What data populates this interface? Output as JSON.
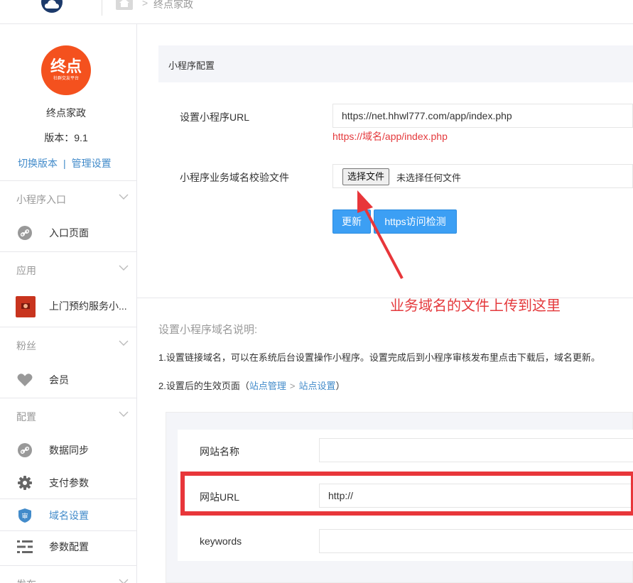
{
  "header": {
    "breadcrumb_sep": ">",
    "breadcrumb_current": "终点家政"
  },
  "sidebar": {
    "logo_big": "终点",
    "logo_small": "社群交友平台",
    "account_name": "终点家政",
    "version": "版本：9.1",
    "switch_version": "切换版本",
    "link_sep": "|",
    "manage_settings": "管理设置",
    "sections": [
      {
        "title": "小程序入口",
        "items": [
          {
            "label": "入口页面",
            "icon": "link-icon"
          }
        ]
      },
      {
        "title": "应用",
        "items": [
          {
            "label": "上门预约服务小...",
            "icon": "app-thumbnail"
          }
        ]
      },
      {
        "title": "粉丝",
        "items": [
          {
            "label": "会员",
            "icon": "heart-icon"
          }
        ]
      },
      {
        "title": "配置",
        "items": [
          {
            "label": "数据同步",
            "icon": "link-icon"
          },
          {
            "label": "支付参数",
            "icon": "gear-icon"
          },
          {
            "label": "域名设置",
            "icon": "shield-icon",
            "active": true
          },
          {
            "label": "参数配置",
            "icon": "sliders-icon"
          }
        ]
      },
      {
        "title": "发布"
      }
    ]
  },
  "main": {
    "panel_title": "小程序配置",
    "url_label": "设置小程序URL",
    "url_value": "https://net.hhwl777.com/app/index.php",
    "url_hint": "https://域名/app/index.php",
    "file_label": "小程序业务域名校验文件",
    "file_button": "选择文件",
    "file_none": "未选择任何文件",
    "update_button": "更新",
    "check_button": "https访问检测",
    "annotation": "业务域名的文件上传到这里",
    "desc_title": "设置小程序域名说明:",
    "desc_1": "1.设置链接域名，可以在系统后台设置操作小程序。设置完成后到小程序审核发布里点击下载后，域名更新。",
    "desc_2_prefix": "2.设置后的生效页面（",
    "desc_2_link1": "站点管理",
    "desc_2_arrow": ">",
    "desc_2_link2": "站点设置",
    "desc_2_suffix": "）",
    "preview": {
      "site_name_label": "网站名称",
      "site_name_value": "",
      "site_url_label": "网站URL",
      "site_url_value": "http://",
      "keywords_label": "keywords",
      "keywords_value": ""
    }
  },
  "colors": {
    "accent": "#428bca",
    "button": "#3c9ff4",
    "annotation_red": "#e4393c",
    "logo_orange": "#f4511e"
  }
}
